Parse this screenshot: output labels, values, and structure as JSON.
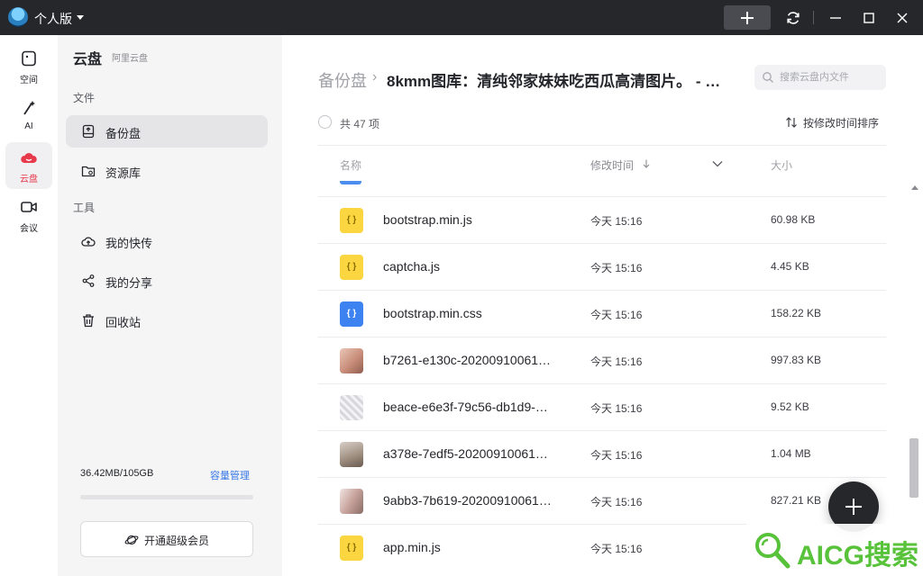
{
  "titlebar": {
    "edition": "个人版"
  },
  "rail": [
    {
      "label": "空间",
      "icon": "space-icon",
      "active": false
    },
    {
      "label": "AI",
      "icon": "ai-wand-icon",
      "active": false
    },
    {
      "label": "云盘",
      "icon": "cloud-drive-icon",
      "active": true
    },
    {
      "label": "会议",
      "icon": "video-meeting-icon",
      "active": false
    }
  ],
  "sidebar": {
    "title": "云盘",
    "subtitle": "阿里云盘",
    "group_files": "文件",
    "group_tools": "工具",
    "items": [
      {
        "label": "备份盘",
        "icon": "backup-drive-icon",
        "active": true
      },
      {
        "label": "资源库",
        "icon": "resource-folder-icon",
        "active": false
      },
      {
        "label": "我的快传",
        "icon": "cloud-upload-icon",
        "active": false
      },
      {
        "label": "我的分享",
        "icon": "share-icon",
        "active": false
      },
      {
        "label": "回收站",
        "icon": "trash-icon",
        "active": false
      }
    ],
    "usage": "36.42MB/105GB",
    "usage_fraction": 0.0003,
    "manage_label": "容量管理",
    "vip_label": "开通超级会员"
  },
  "main": {
    "breadcrumb_root": "备份盘",
    "breadcrumb_sep": "›",
    "breadcrumb_current": "8kmm图库：清纯邻家妹妹吃西瓜高清图片。 - …",
    "search_placeholder": "搜索云盘内文件",
    "count": "共 47 项",
    "sort_label": "按修改时间排序",
    "columns": {
      "name": "名称",
      "time": "修改时间",
      "size": "大小"
    },
    "files": [
      {
        "name": "bootstrap.min.js",
        "time": "今天 15:16",
        "size": "60.98 KB",
        "kind": "js"
      },
      {
        "name": "captcha.js",
        "time": "今天 15:16",
        "size": "4.45 KB",
        "kind": "js"
      },
      {
        "name": "bootstrap.min.css",
        "time": "今天 15:16",
        "size": "158.22 KB",
        "kind": "css"
      },
      {
        "name": "b7261-e130c-20200910061…",
        "time": "今天 15:16",
        "size": "997.83 KB",
        "kind": "img1"
      },
      {
        "name": "beace-e6e3f-79c56-db1d9-…",
        "time": "今天 15:16",
        "size": "9.52 KB",
        "kind": "img2"
      },
      {
        "name": "a378e-7edf5-20200910061…",
        "time": "今天 15:16",
        "size": "1.04 MB",
        "kind": "img3"
      },
      {
        "name": "9abb3-7b619-20200910061…",
        "time": "今天 15:16",
        "size": "827.21 KB",
        "kind": "img4"
      },
      {
        "name": "app.min.js",
        "time": "今天 15:16",
        "size": "",
        "kind": "js"
      }
    ]
  },
  "watermark": {
    "text": "AICG搜索"
  },
  "colors": {
    "accent": "#e8384b",
    "link": "#3778e6",
    "titlebar": "#26272b",
    "watermark": "#58c23a"
  }
}
